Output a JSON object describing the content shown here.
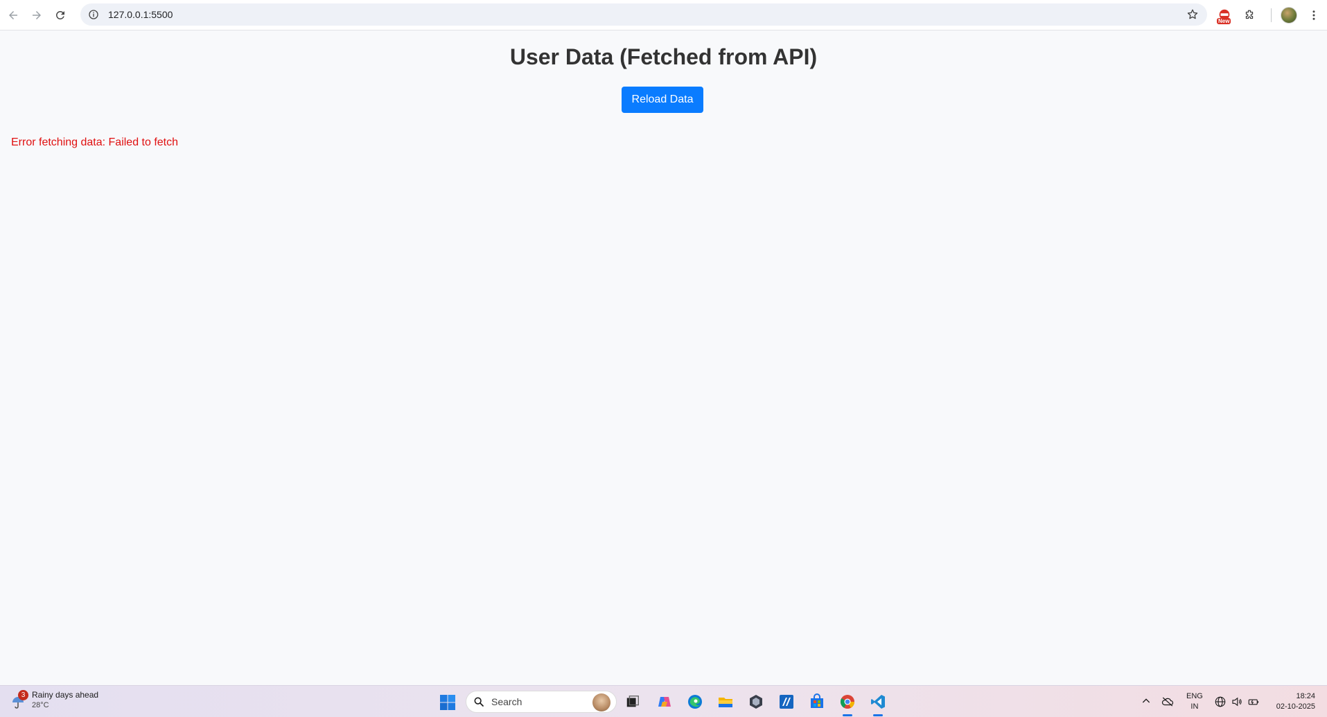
{
  "browser": {
    "url": "127.0.0.1:5500",
    "ext_badge": "New"
  },
  "page": {
    "title": "User Data (Fetched from API)",
    "reload_label": "Reload Data",
    "error": "Error fetching data: Failed to fetch",
    "colors": {
      "button": "#0a7cff",
      "error": "#e01010",
      "title": "#333333"
    }
  },
  "taskbar": {
    "weather": {
      "badge": "3",
      "title": "Rainy days ahead",
      "temp": "28°C"
    },
    "search_placeholder": "Search",
    "lang_top": "ENG",
    "lang_bottom": "IN",
    "time": "18:24",
    "date": "02-10-2025"
  }
}
